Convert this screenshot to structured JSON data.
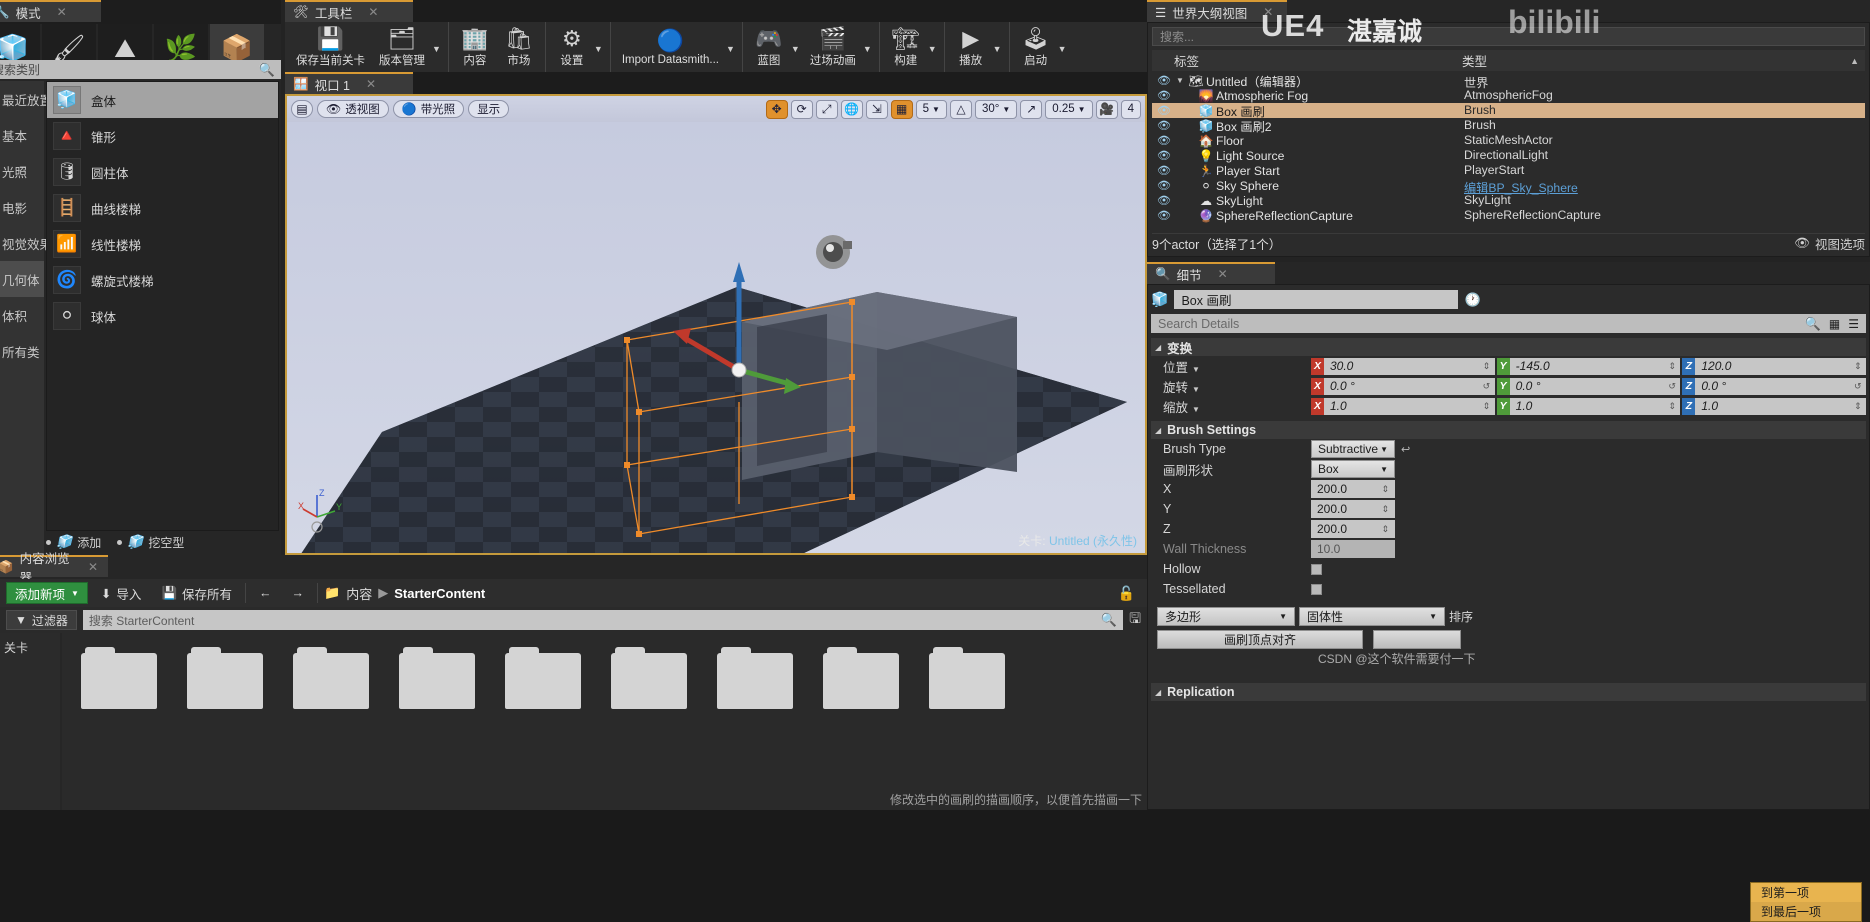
{
  "modes": {
    "tab_title": "模式",
    "search_placeholder": "搜索类别",
    "mode_icons": [
      {
        "name": "place-mode",
        "glyph": "🧊"
      },
      {
        "name": "paint-mode",
        "glyph": "🖌"
      },
      {
        "name": "landscape-mode",
        "glyph": "⛰"
      },
      {
        "name": "foliage-mode",
        "glyph": "🌿"
      },
      {
        "name": "geometry-edit-mode",
        "glyph": "📦"
      }
    ],
    "categories": [
      {
        "label": "最近放置",
        "selected": false
      },
      {
        "label": "基本",
        "selected": false
      },
      {
        "label": "光照",
        "selected": false
      },
      {
        "label": "电影",
        "selected": false
      },
      {
        "label": "视觉效果",
        "selected": false
      },
      {
        "label": "几何体",
        "selected": true
      },
      {
        "label": "体积",
        "selected": false
      },
      {
        "label": "所有类",
        "selected": false
      }
    ],
    "geometry": [
      {
        "label": "盒体",
        "glyph": "🧊",
        "selected": true
      },
      {
        "label": "锥形",
        "glyph": "🔺",
        "selected": false
      },
      {
        "label": "圆柱体",
        "glyph": "🛢",
        "selected": false
      },
      {
        "label": "曲线楼梯",
        "glyph": "🪜",
        "selected": false
      },
      {
        "label": "线性楼梯",
        "glyph": "📶",
        "selected": false
      },
      {
        "label": "螺旋式楼梯",
        "glyph": "🌀",
        "selected": false
      },
      {
        "label": "球体",
        "glyph": "⚪",
        "selected": false
      }
    ],
    "footer": [
      {
        "label": "添加",
        "glyph": "🧊"
      },
      {
        "label": "挖空型",
        "glyph": "🧊"
      }
    ]
  },
  "toolbar": {
    "tab_title": "工具栏",
    "groups": [
      {
        "items": [
          {
            "label": "保存当前关卡",
            "icon": "save-icon",
            "glyph": "💾",
            "caret": false
          },
          {
            "label": "版本管理",
            "icon": "source-control-icon",
            "glyph": "🗂",
            "caret": true
          }
        ]
      },
      {
        "items": [
          {
            "label": "内容",
            "icon": "content-icon",
            "glyph": "🏢",
            "caret": false
          },
          {
            "label": "市场",
            "icon": "marketplace-icon",
            "glyph": "🛍",
            "caret": false
          }
        ]
      },
      {
        "items": [
          {
            "label": "设置",
            "icon": "settings-icon",
            "glyph": "⚙",
            "caret": true
          }
        ]
      },
      {
        "items": [
          {
            "label": "Import Datasmith...",
            "icon": "datasmith-icon",
            "glyph": "🔵",
            "caret": true
          }
        ]
      },
      {
        "items": [
          {
            "label": "蓝图",
            "icon": "blueprint-icon",
            "glyph": "🎮",
            "caret": true
          },
          {
            "label": "过场动画",
            "icon": "cinematics-icon",
            "glyph": "🎬",
            "caret": true
          }
        ]
      },
      {
        "items": [
          {
            "label": "构建",
            "icon": "build-icon",
            "glyph": "🏗",
            "caret": true
          }
        ]
      },
      {
        "items": [
          {
            "label": "播放",
            "icon": "play-icon",
            "glyph": "▶",
            "caret": true
          }
        ]
      },
      {
        "items": [
          {
            "label": "启动",
            "icon": "launch-icon",
            "glyph": "🕹",
            "caret": true
          }
        ]
      }
    ]
  },
  "viewport": {
    "tab_title": "视口 1",
    "buttons": [
      {
        "name": "viewport-menu-button",
        "label": "",
        "glyph": "▤"
      },
      {
        "name": "perspective-button",
        "label": "透视图",
        "glyph": "👁"
      },
      {
        "name": "lit-button",
        "label": "带光照",
        "glyph": "🔵"
      },
      {
        "name": "show-button",
        "label": "显示",
        "glyph": ""
      }
    ],
    "right_controls": [
      {
        "name": "translate-gizmo-toggle",
        "glyph": "✥",
        "active": true
      },
      {
        "name": "rotate-gizmo-toggle",
        "glyph": "⟳",
        "active": false
      },
      {
        "name": "scale-gizmo-toggle",
        "glyph": "⤢",
        "active": false
      },
      {
        "name": "world-space-toggle",
        "glyph": "🌐",
        "active": false
      },
      {
        "name": "surface-snap-toggle",
        "glyph": "⇲",
        "active": false
      },
      {
        "name": "grid-snap-toggle",
        "glyph": "▦",
        "active": true
      }
    ],
    "grid_snap_value": "5",
    "angle_snap_icon": "△",
    "angle_snap_value": "30°",
    "scale_snap_icon": "↗",
    "scale_snap_value": "0.25",
    "camera_speed_icon": "🎥",
    "camera_speed_value": "4",
    "level_label": "关卡:",
    "level_name": "Untitled (永久性)",
    "axis_labels": {
      "x": "X",
      "y": "Y",
      "z": "Z"
    }
  },
  "content_browser": {
    "tab_title": "内容浏览器",
    "add_new_label": "添加新项",
    "import_label": "导入",
    "save_all_label": "保存所有",
    "back_icon": "←",
    "forward_icon": "→",
    "breadcrumb": [
      "内容",
      "StarterContent"
    ],
    "breadcrumb_separator": "▶",
    "folder_icon": "📁",
    "lock_icon": "🔓",
    "filter_label": "过滤器",
    "search_placeholder": "搜索 StarterContent",
    "save_icon": "💾",
    "sources_label": "关卡",
    "assets": [
      {
        "name": "folder-1"
      },
      {
        "name": "folder-2"
      },
      {
        "name": "folder-3"
      },
      {
        "name": "folder-4"
      },
      {
        "name": "folder-5"
      },
      {
        "name": "folder-6"
      },
      {
        "name": "folder-7"
      },
      {
        "name": "folder-8"
      },
      {
        "name": "folder-9"
      }
    ]
  },
  "outliner": {
    "tab_title": "世界大纲视图",
    "search_placeholder": "搜索...",
    "columns": [
      "标签",
      "类型"
    ],
    "rows": [
      {
        "label": "Untitled（编辑器）",
        "type": "世界",
        "icon": "world-icon",
        "glyph": "🗺",
        "indent": 0,
        "expander": true,
        "selected": false,
        "link": false
      },
      {
        "label": "Atmospheric Fog",
        "type": "AtmosphericFog",
        "icon": "fog-icon",
        "glyph": "🌄",
        "indent": 1,
        "expander": false,
        "selected": false,
        "link": false
      },
      {
        "label": "Box 画刷",
        "type": "Brush",
        "icon": "brush-icon",
        "glyph": "🧊",
        "indent": 1,
        "expander": false,
        "selected": true,
        "link": false
      },
      {
        "label": "Box 画刷2",
        "type": "Brush",
        "icon": "brush-icon",
        "glyph": "🧊",
        "indent": 1,
        "expander": false,
        "selected": false,
        "link": false
      },
      {
        "label": "Floor",
        "type": "StaticMeshActor",
        "icon": "mesh-icon",
        "glyph": "🏠",
        "indent": 1,
        "expander": false,
        "selected": false,
        "link": false
      },
      {
        "label": "Light Source",
        "type": "DirectionalLight",
        "icon": "light-icon",
        "glyph": "💡",
        "indent": 1,
        "expander": false,
        "selected": false,
        "link": false
      },
      {
        "label": "Player Start",
        "type": "PlayerStart",
        "icon": "player-icon",
        "glyph": "🏃",
        "indent": 1,
        "expander": false,
        "selected": false,
        "link": false
      },
      {
        "label": "Sky Sphere",
        "type": "编辑BP_Sky_Sphere",
        "icon": "sphere-icon",
        "glyph": "⚪",
        "indent": 1,
        "expander": false,
        "selected": false,
        "link": true
      },
      {
        "label": "SkyLight",
        "type": "SkyLight",
        "icon": "skylight-icon",
        "glyph": "☁",
        "indent": 1,
        "expander": false,
        "selected": false,
        "link": false
      },
      {
        "label": "SphereReflectionCapture",
        "type": "SphereReflectionCapture",
        "icon": "reflection-icon",
        "glyph": "🔮",
        "indent": 1,
        "expander": false,
        "selected": false,
        "link": false
      }
    ],
    "status": "9个actor（选择了1个）",
    "view_options_label": "视图选项",
    "view_options_icon": "👁"
  },
  "details": {
    "tab_title": "细节",
    "actor_name": "Box 画刷",
    "search_placeholder": "Search Details",
    "transform_section": "变换",
    "transform_rows": [
      {
        "label": "位置",
        "caret": true,
        "x": "30.0",
        "y": "-145.0",
        "z": "120.0",
        "reset": false
      },
      {
        "label": "旋转",
        "caret": true,
        "x": "0.0 °",
        "y": "0.0 °",
        "z": "0.0 °",
        "reset": true
      },
      {
        "label": "缩放",
        "caret": true,
        "x": "1.0",
        "y": "1.0",
        "z": "1.0",
        "reset": false
      }
    ],
    "brush_section": "Brush Settings",
    "brush_rows": [
      {
        "label": "Brush Type",
        "kind": "combo",
        "value": "Subtractive",
        "dim": false,
        "reset": true
      },
      {
        "label": "画刷形状",
        "kind": "combo",
        "value": "Box",
        "dim": false,
        "reset": false
      },
      {
        "label": "X",
        "kind": "text",
        "value": "200.0",
        "dim": false,
        "reset": true
      },
      {
        "label": "Y",
        "kind": "text",
        "value": "200.0",
        "dim": false,
        "reset": true
      },
      {
        "label": "Z",
        "kind": "text",
        "value": "200.0",
        "dim": false,
        "reset": true
      },
      {
        "label": "Wall Thickness",
        "kind": "text",
        "value": "10.0",
        "dim": true,
        "reset": false
      },
      {
        "label": "Hollow",
        "kind": "check",
        "value": "",
        "dim": false,
        "reset": false
      },
      {
        "label": "Tessellated",
        "kind": "check",
        "value": "",
        "dim": false,
        "reset": false
      }
    ],
    "poly_dropdown": "多边形",
    "solidity_dropdown": "固体性",
    "order_label": "排序",
    "align_button": "画刷顶点对齐",
    "replication_section": "Replication",
    "context_menu": [
      {
        "label": "到第一项",
        "highlighted": true
      },
      {
        "label": "到最后一项",
        "highlighted": false
      }
    ]
  },
  "watermarks": {
    "ue4": "UE4",
    "author": "湛嘉诚",
    "site": "bilibili",
    "csdn": "CSDN @这个软件需要付一下",
    "bottom_hint": "修改选中的画刷的描画顺序，以便首先描画一下"
  },
  "colors": {
    "accent_orange": "#c49a3c",
    "selection_tan": "#d7b189",
    "green_button": "#2f8f3f",
    "axis_x": "#c0392b",
    "axis_y": "#4f9b3a",
    "axis_z": "#2f6fb5",
    "link_blue": "#5c9fd6",
    "menu_gold": "#d9a84a"
  }
}
